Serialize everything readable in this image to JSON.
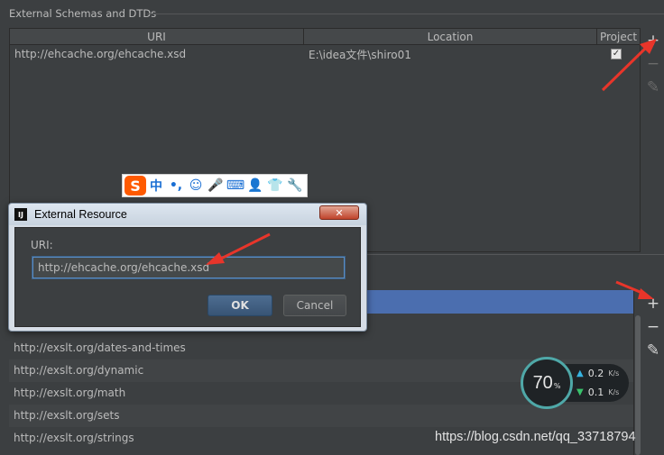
{
  "section": {
    "title": "External Schemas and DTDs"
  },
  "top_table": {
    "columns": [
      "URI",
      "Location",
      "Project"
    ],
    "rows": [
      {
        "uri": "http://ehcache.org/ehcache.xsd",
        "location": "E:\\idea文件\\shiro01",
        "project_checked": "✓"
      }
    ]
  },
  "tools_top": {
    "add": "+",
    "remove": "−",
    "edit": "✎"
  },
  "tools_bottom": {
    "add": "+",
    "remove": "−",
    "edit": "✎"
  },
  "bottom_list": {
    "items": [
      "http://exslt.org/dates-and-times",
      "http://exslt.org/dynamic",
      "http://exslt.org/math",
      "http://exslt.org/sets",
      "http://exslt.org/strings"
    ]
  },
  "ime_toolbar": {
    "logo": "S",
    "items": [
      "中",
      "•,",
      "☺",
      "🎤",
      "⌨",
      "👤",
      "👕",
      "🔧"
    ]
  },
  "dialog": {
    "app_icon": "IJ",
    "title": "External Resource",
    "close": "✕",
    "uri_label": "URI:",
    "uri_value": "http://ehcache.org/ehcache.xsd",
    "ok_label": "OK",
    "cancel_label": "Cancel"
  },
  "speed_widget": {
    "percent": "70",
    "percent_sign": "%",
    "upload": "0.2",
    "download": "0.1",
    "unit": "K/s"
  },
  "watermark": "https://blog.csdn.net/qq_33718794",
  "colors": {
    "background": "#3c3f41",
    "selection": "#4b6eaf",
    "annotation_arrow": "#e8352a"
  }
}
